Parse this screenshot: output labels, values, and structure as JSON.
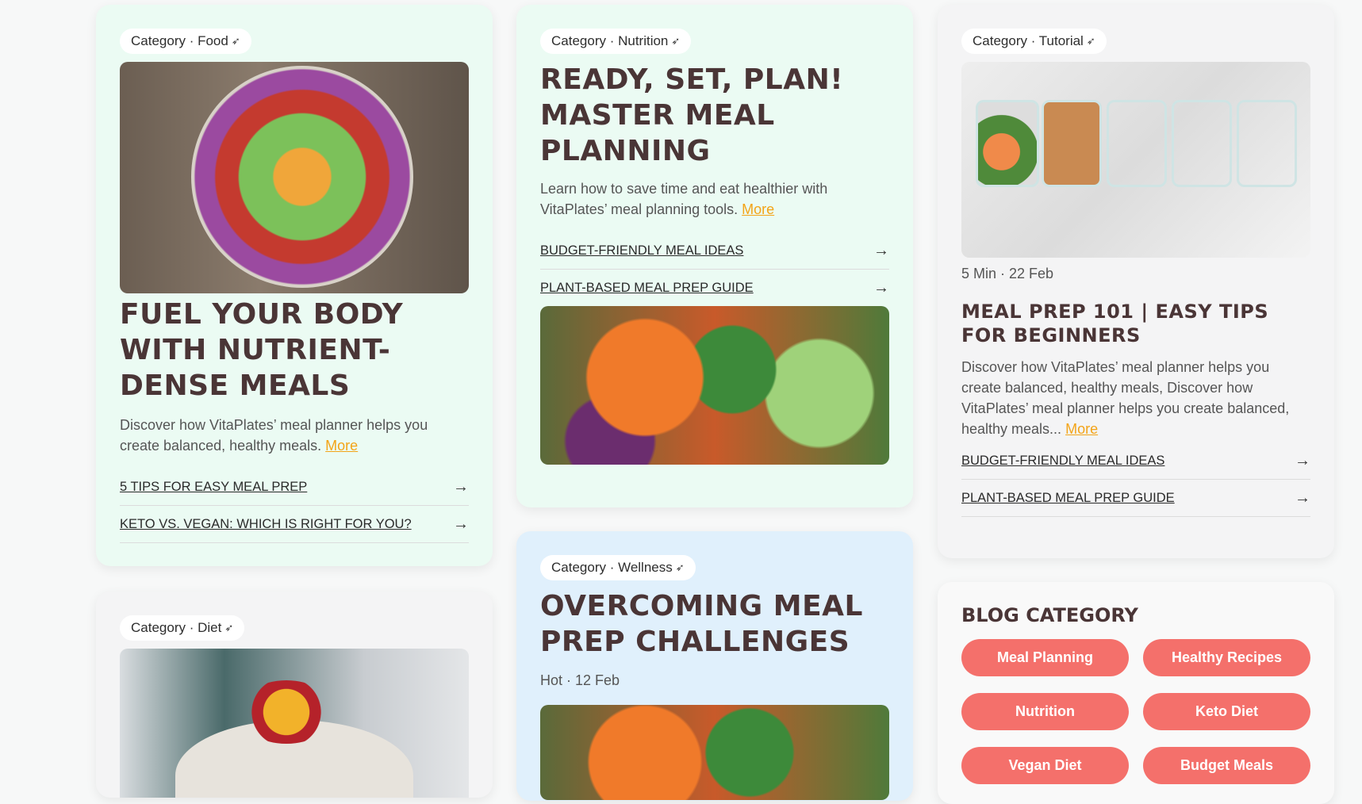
{
  "cards": {
    "food": {
      "category": "Category · Food",
      "title": "FUEL YOUR BODY WITH NUTRIENT-DENSE MEALS",
      "desc": "Discover how VitaPlates’ meal planner helps you create balanced, healthy meals.",
      "more": "More",
      "links": [
        "5 TIPS FOR EASY MEAL PREP",
        "KETO VS. VEGAN: WHICH IS RIGHT FOR YOU?"
      ]
    },
    "nutrition": {
      "category": "Category · Nutrition",
      "title": "READY, SET, PLAN! MASTER MEAL PLANNING",
      "desc": "Learn how to save time and eat healthier with VitaPlates’ meal planning tools.",
      "more": "More",
      "links": [
        "BUDGET-FRIENDLY MEAL IDEAS",
        "PLANT-BASED MEAL PREP GUIDE"
      ]
    },
    "tutorial": {
      "category": "Category · Tutorial",
      "meta": "5 Min · 22 Feb",
      "title": "MEAL PREP 101 | EASY TIPS FOR BEGINNERS",
      "desc": "Discover how VitaPlates’ meal planner helps you create balanced, healthy meals, Discover how VitaPlates’ meal planner helps you create balanced, healthy meals...",
      "more": "More",
      "links": [
        "BUDGET-FRIENDLY MEAL IDEAS",
        "PLANT-BASED MEAL PREP GUIDE"
      ]
    },
    "diet": {
      "category": "Category · Diet"
    },
    "wellness": {
      "category": "Category · Wellness",
      "title": "OVERCOMING MEAL PREP CHALLENGES",
      "meta": "Hot · 12 Feb"
    }
  },
  "blog_category": {
    "heading": "BLOG CATEGORY",
    "chips": [
      "Meal Planning",
      "Healthy Recipes",
      "Nutrition",
      "Keto Diet",
      "Vegan Diet",
      "Budget Meals"
    ]
  },
  "arrow_glyph": "→",
  "rocket_glyph": "➶"
}
